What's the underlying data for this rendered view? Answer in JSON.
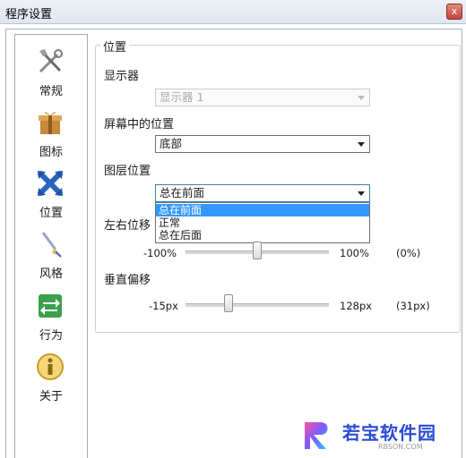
{
  "window": {
    "title": "程序设置",
    "close_label": "x"
  },
  "sidebar": {
    "items": [
      {
        "label": "常规",
        "icon": "tools-icon"
      },
      {
        "label": "图标",
        "icon": "gift-box-icon"
      },
      {
        "label": "位置",
        "icon": "move-arrows-icon"
      },
      {
        "label": "风格",
        "icon": "brush-icon"
      },
      {
        "label": "行为",
        "icon": "swap-arrows-icon"
      },
      {
        "label": "关于",
        "icon": "info-icon"
      }
    ]
  },
  "panel": {
    "group_title": "位置",
    "display": {
      "label": "显示器",
      "value": "显示器 1",
      "enabled": false
    },
    "screen_position": {
      "label": "屏幕中的位置",
      "value": "底部"
    },
    "layer_position": {
      "label": "图层位置",
      "value": "总在前面",
      "options": [
        "总在前面",
        "正常",
        "总在后面"
      ],
      "highlighted_index": 0
    },
    "horizontal_offset": {
      "label": "左右位移",
      "min": "-100%",
      "max": "100%",
      "current": "(0%)",
      "value_fraction": 0.5
    },
    "vertical_offset": {
      "label": "垂直偏移",
      "min": "-15px",
      "max": "128px",
      "current": "(31px)",
      "value_fraction": 0.3
    }
  },
  "watermark": {
    "text": "若宝软件园",
    "sub": "RBSON.COM",
    "letter": "R"
  },
  "colors": {
    "selection": "#3399ff",
    "accent": "#2b4bd6"
  }
}
